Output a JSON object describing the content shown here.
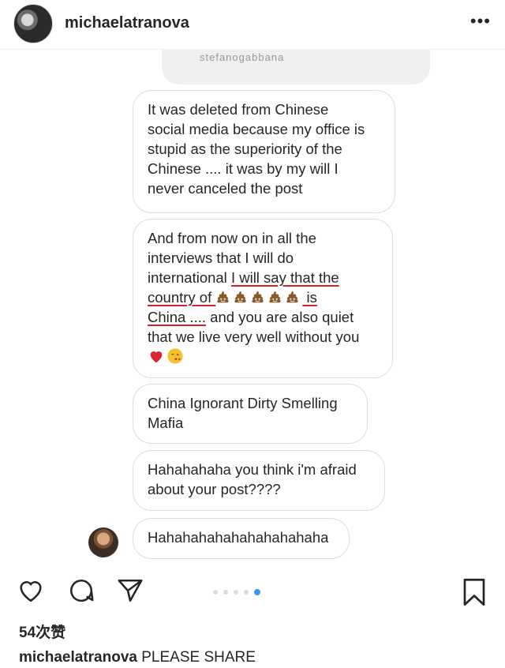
{
  "post": {
    "username": "michaelatranova",
    "more_icon": "more-icon"
  },
  "screenshot": {
    "top_bubble_text": "stefanogabbana",
    "messages": [
      {
        "lines": [
          "It was deleted from Chinese",
          "social media because my office is",
          "stupid as the superiority of the",
          "Chinese .... it was by my will I",
          "never canceled the post"
        ]
      },
      {
        "line1": "And from now on in all the",
        "line2": "interviews that I will do",
        "line3a": "international ",
        "line3b": "I will say that the",
        "line4a": "country of ",
        "line4b": " is",
        "line5a": "China ....",
        "line5b": " and you are also quiet",
        "line6": "that we live very well without you",
        "emoji_count": 5
      },
      {
        "lines": [
          "China Ignorant Dirty Smelling",
          "Mafia"
        ]
      },
      {
        "lines": [
          "Hahahahaha you think i'm afraid",
          "about your post????"
        ]
      },
      {
        "lines": [
          "Hahahahahahahahahahaha"
        ]
      }
    ]
  },
  "actions": {
    "like_icon": "heart-icon",
    "comment_icon": "comment-icon",
    "share_icon": "send-icon",
    "save_icon": "bookmark-icon",
    "carousel_total": 5,
    "carousel_active": 5
  },
  "likes": "54次赞",
  "caption": {
    "username": "michaelatranova",
    "text": "PLEASE SHARE"
  },
  "colors": {
    "accent": "#3897f0",
    "underline": "#d2232a",
    "text": "#262626"
  }
}
